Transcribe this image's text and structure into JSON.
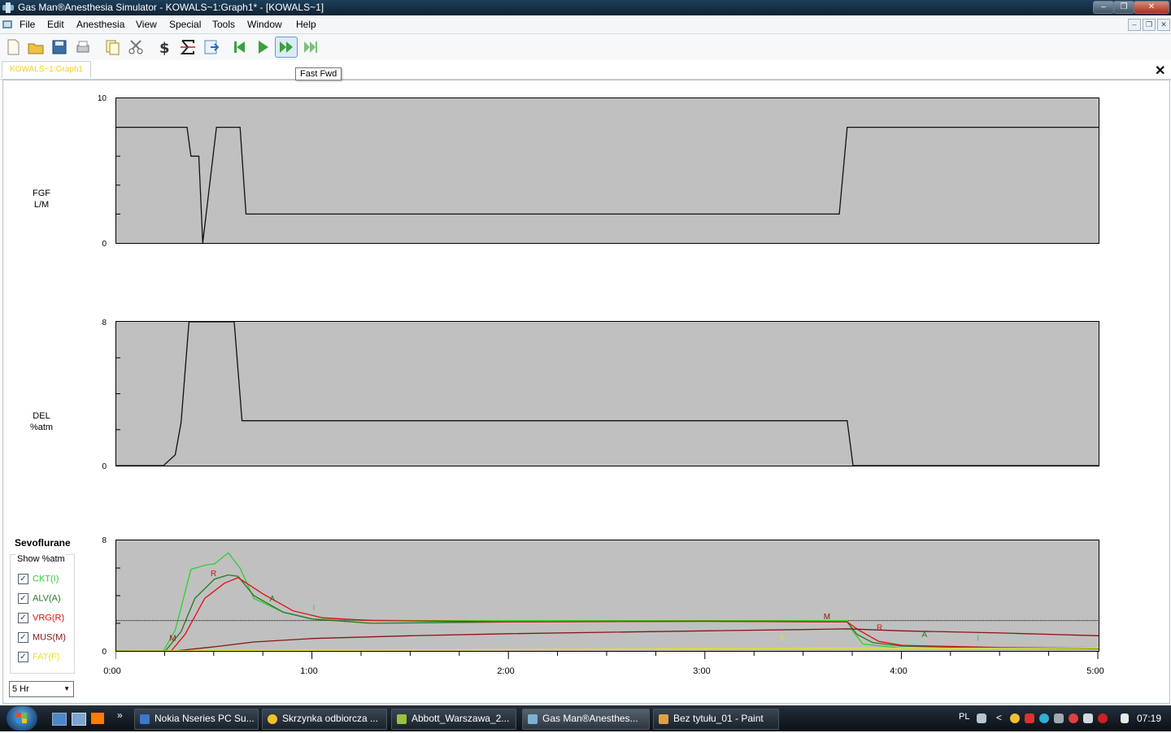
{
  "window": {
    "title": "Gas Man®Anesthesia Simulator - KOWALS~1:Graph1* - [KOWALS~1]"
  },
  "menu": [
    "File",
    "Edit",
    "Anesthesia",
    "View",
    "Special",
    "Tools",
    "Window",
    "Help"
  ],
  "tooltip": "Fast Fwd",
  "tab": {
    "label": "KOWALS~1:Graph1"
  },
  "graphs": {
    "fgf": {
      "label1": "FGF",
      "label2": "L/M",
      "ymax": "10",
      "ymin": "0"
    },
    "del": {
      "label1": "DEL",
      "label2": "%atm",
      "ymax": "8",
      "ymin": "0"
    },
    "agent": {
      "ymax": "8",
      "ymin": "0"
    }
  },
  "x_ticks": [
    "0:00",
    "1:00",
    "2:00",
    "3:00",
    "4:00",
    "5:00"
  ],
  "agent_panel": {
    "name": "Sevoflurane",
    "show_label": "Show %atm",
    "checkboxes": [
      {
        "label": "CKT(I)",
        "checked": true,
        "color": "#33cc33"
      },
      {
        "label": "ALV(A)",
        "checked": true,
        "color": "#227722"
      },
      {
        "label": "VRG(R)",
        "checked": true,
        "color": "#dd1111"
      },
      {
        "label": "MUS(M)",
        "checked": true,
        "color": "#8a1414"
      },
      {
        "label": "FAT(F)",
        "checked": true,
        "color": "#e8e020"
      }
    ],
    "time_scale": "5 Hr"
  },
  "curve_letters": [
    {
      "letter": "M",
      "t": 0.27,
      "v": 0.75,
      "color": "#8a1414"
    },
    {
      "letter": "R",
      "t": 0.48,
      "v": 5.4,
      "color": "#dd1111"
    },
    {
      "letter": "A",
      "t": 0.78,
      "v": 3.6,
      "color": "#227722"
    },
    {
      "letter": "I",
      "t": 1.0,
      "v": 2.95,
      "color": "#33cc33"
    },
    {
      "letter": "M",
      "t": 3.6,
      "v": 2.3,
      "color": "#8a1414"
    },
    {
      "letter": "F",
      "t": 3.38,
      "v": 0.7,
      "color": "#e8e020"
    },
    {
      "letter": "R",
      "t": 3.87,
      "v": 1.5,
      "color": "#dd1111"
    },
    {
      "letter": "A",
      "t": 4.1,
      "v": 1.0,
      "color": "#227722"
    },
    {
      "letter": "I",
      "t": 4.38,
      "v": 0.75,
      "color": "#33cc33"
    }
  ],
  "chart_data": [
    {
      "type": "line",
      "ylabel": "FGF L/M",
      "ylim": [
        0,
        10
      ],
      "xlim": [
        "0:00",
        "5:00"
      ],
      "x_hours": [
        0,
        0.36,
        0.38,
        0.42,
        0.44,
        0.51,
        0.63,
        0.66,
        3.68,
        3.72,
        5.0
      ],
      "values": [
        8,
        8,
        6,
        6,
        0,
        8,
        8,
        2,
        2,
        8,
        8
      ]
    },
    {
      "type": "line",
      "ylabel": "DEL %atm",
      "ylim": [
        0,
        8
      ],
      "xlim": [
        "0:00",
        "5:00"
      ],
      "x_hours": [
        0,
        0.24,
        0.3,
        0.33,
        0.37,
        0.6,
        0.64,
        3.72,
        3.75,
        5.0
      ],
      "values": [
        0,
        0,
        0.6,
        2.4,
        8,
        8,
        2.5,
        2.5,
        0,
        0
      ]
    },
    {
      "type": "line",
      "ylim": [
        0,
        8
      ],
      "xlim": [
        "0:00",
        "5:00"
      ],
      "reference_level": 2.2,
      "series": [
        {
          "name": "CKT(I)",
          "color": "#33cc33",
          "x_hours": [
            0,
            0.24,
            0.3,
            0.38,
            0.45,
            0.5,
            0.57,
            0.63,
            0.7,
            0.85,
            1.0,
            1.5,
            2.0,
            3.0,
            3.72,
            3.75,
            3.8,
            4.0,
            5.0
          ],
          "values": [
            0,
            0,
            1.5,
            5.9,
            6.2,
            6.3,
            7.1,
            6.0,
            3.8,
            2.8,
            2.3,
            2.2,
            2.2,
            2.2,
            2.2,
            1.4,
            0.5,
            0.2,
            0.2
          ]
        },
        {
          "name": "ALV(A)",
          "color": "#227722",
          "x_hours": [
            0,
            0.25,
            0.33,
            0.4,
            0.5,
            0.57,
            0.62,
            0.7,
            0.85,
            1.0,
            1.3,
            2.0,
            3.0,
            3.72,
            3.77,
            3.85,
            4.0,
            4.5,
            5.0
          ],
          "values": [
            0,
            0,
            1.4,
            3.8,
            5.2,
            5.5,
            5.4,
            4.0,
            2.8,
            2.3,
            2.0,
            2.1,
            2.15,
            2.1,
            1.2,
            0.6,
            0.35,
            0.2,
            0.15
          ]
        },
        {
          "name": "VRG(R)",
          "color": "#dd1111",
          "x_hours": [
            0,
            0.28,
            0.35,
            0.45,
            0.55,
            0.62,
            0.75,
            0.9,
            1.05,
            1.3,
            2.0,
            3.0,
            3.72,
            3.78,
            3.88,
            4.0,
            4.5,
            5.0
          ],
          "values": [
            0,
            0,
            1.2,
            3.8,
            4.9,
            5.3,
            4.1,
            2.9,
            2.4,
            2.2,
            2.1,
            2.15,
            2.1,
            1.5,
            0.7,
            0.4,
            0.25,
            0.2
          ]
        },
        {
          "name": "MUS(M)",
          "color": "#8a1414",
          "x_hours": [
            0,
            0.3,
            0.5,
            0.7,
            1.0,
            1.5,
            2.0,
            2.5,
            3.0,
            3.5,
            3.72,
            4.0,
            4.5,
            5.0
          ],
          "values": [
            0,
            0,
            0.3,
            0.65,
            0.9,
            1.1,
            1.25,
            1.35,
            1.45,
            1.55,
            1.6,
            1.45,
            1.3,
            1.1
          ]
        },
        {
          "name": "FAT(F)",
          "color": "#e8e020",
          "x_hours": [
            0,
            0.5,
            1.0,
            2.0,
            3.0,
            3.72,
            4.0,
            5.0
          ],
          "values": [
            0,
            0.02,
            0.05,
            0.1,
            0.16,
            0.2,
            0.2,
            0.2
          ]
        }
      ]
    }
  ],
  "taskbar": {
    "items": [
      "Nokia Nseries PC Su...",
      "Skrzynka odbiorcza ...",
      "Abbott_Warszawa_2...",
      "Gas Man®Anesthes...",
      "Bez tytułu_01 - Paint"
    ],
    "active_index": 3,
    "language": "PL",
    "clock": "07:19",
    "more_glyph": "»",
    "tray_glyph": "<"
  }
}
